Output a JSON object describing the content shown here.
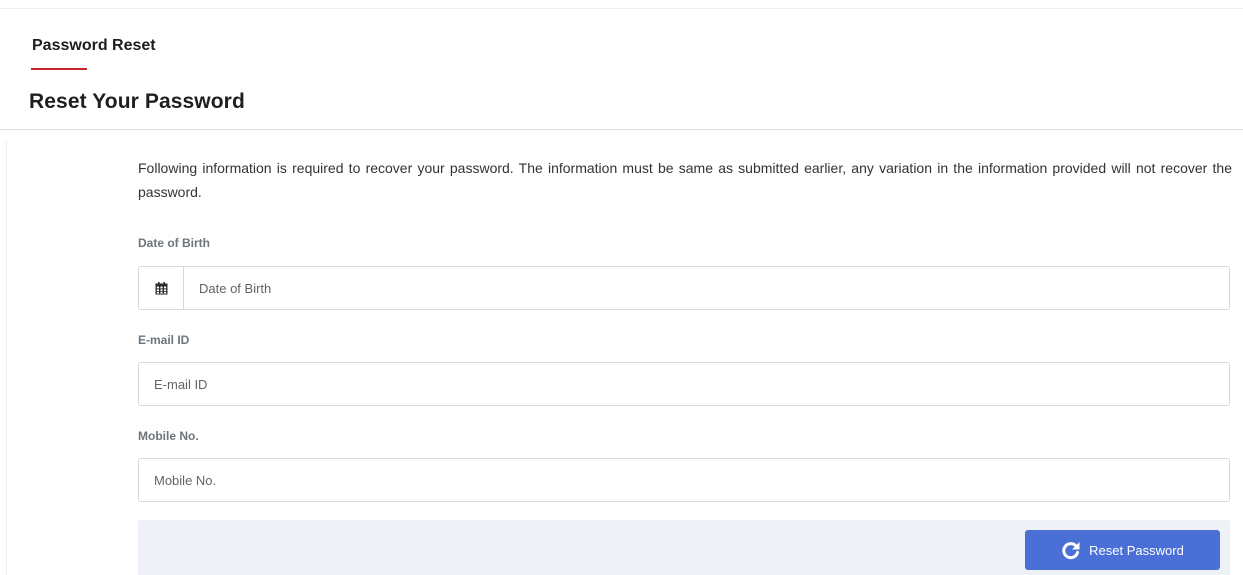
{
  "tab": {
    "label": "Password Reset"
  },
  "page": {
    "title": "Reset Your Password"
  },
  "intro": {
    "text": "Following information is required to recover your password. The information must be same as submitted earlier, any variation in the information provided will not recover the password."
  },
  "form": {
    "dob": {
      "label": "Date of Birth",
      "placeholder": "Date of Birth",
      "value": "",
      "icon": "calendar-icon"
    },
    "email": {
      "label": "E-mail ID",
      "placeholder": "E-mail ID",
      "value": ""
    },
    "mobile": {
      "label": "Mobile No.",
      "placeholder": "Mobile No.",
      "value": ""
    }
  },
  "actions": {
    "reset_label": "Reset Password",
    "reset_icon": "redo-icon"
  },
  "colors": {
    "accent": "#c0262b",
    "button": "#4a6fd6",
    "footer_bg": "#eef1f6"
  }
}
